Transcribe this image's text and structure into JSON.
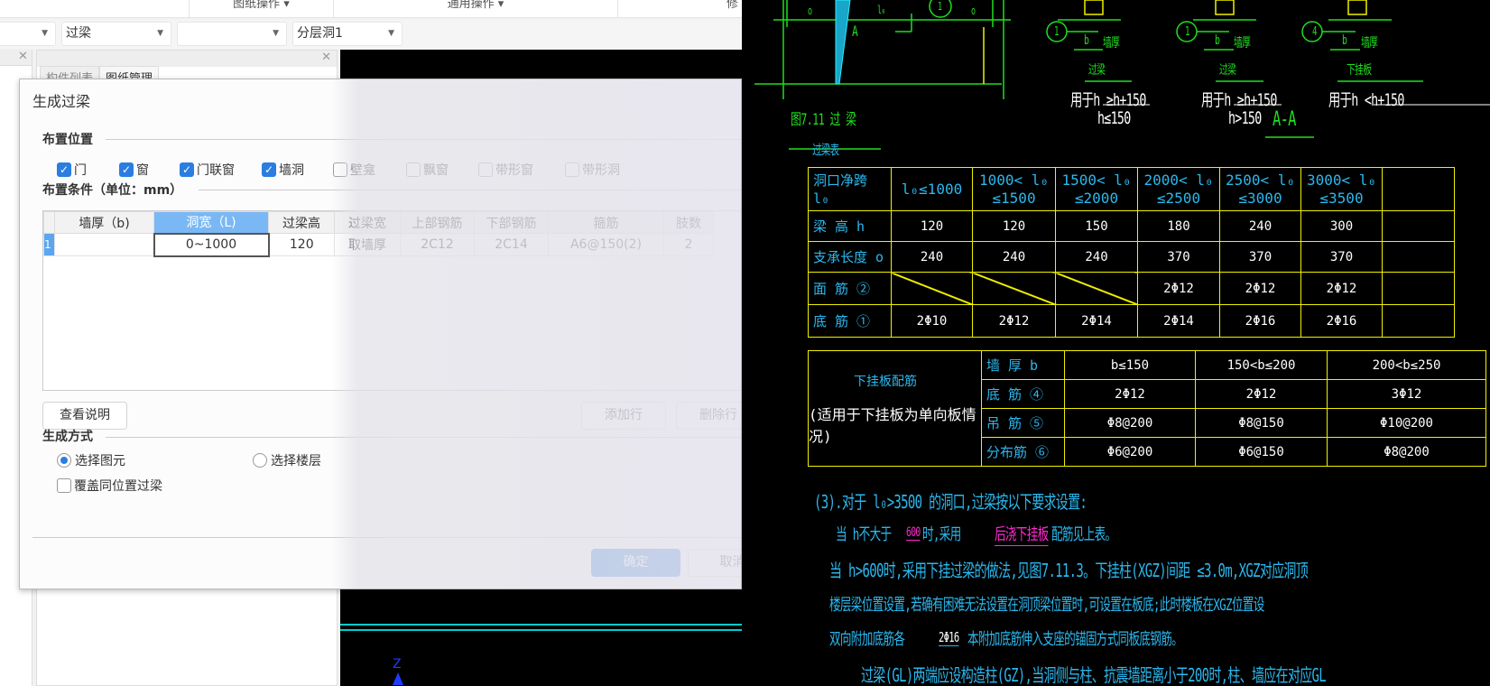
{
  "ribbon": {
    "groups": [
      "图纸操作 ▾",
      "通用操作 ▾",
      "修"
    ]
  },
  "toolbar": {
    "selects": [
      {
        "value": ""
      },
      {
        "value": "过梁"
      },
      {
        "value": ""
      },
      {
        "value": "分层洞1"
      }
    ]
  },
  "panes": {
    "tabs": [
      {
        "label": "构件列表"
      },
      {
        "label": "图纸管理"
      }
    ]
  },
  "dialog": {
    "title": "生成过梁",
    "placement_section": "布置位置",
    "placement_options": [
      {
        "label": "门",
        "checked": true
      },
      {
        "label": "窗",
        "checked": true
      },
      {
        "label": "门联窗",
        "checked": true
      },
      {
        "label": "墙洞",
        "checked": true
      },
      {
        "label": "壁龛",
        "checked": false
      },
      {
        "label": "飘窗",
        "checked": false
      },
      {
        "label": "带形窗",
        "checked": false
      },
      {
        "label": "带形洞",
        "checked": false
      }
    ],
    "conditions_section": "布置条件（单位：mm）",
    "grid": {
      "columns": [
        "墙厚（b)",
        "洞宽（L)",
        "过梁高",
        "过梁宽",
        "上部钢筋",
        "下部钢筋",
        "箍筋",
        "肢数"
      ],
      "rows": [
        {
          "num": "1",
          "cells": [
            "",
            "0~1000",
            "120",
            "取墙厚",
            "2C12",
            "2C14",
            "A6@150(2)",
            "2"
          ]
        }
      ]
    },
    "view_help": "查看说明",
    "add_row": "添加行",
    "delete_row": "删除行",
    "method_section": "生成方式",
    "method_options": [
      {
        "label": "选择图元",
        "selected": true
      },
      {
        "label": "选择楼层",
        "selected": false
      }
    ],
    "overwrite": {
      "label": "覆盖同位置过梁",
      "checked": false
    },
    "ok": "确定",
    "cancel": "取消"
  },
  "cad": {
    "fig_labels": {
      "o1": "o",
      "l0": "l₀",
      "o2": "o",
      "A": "A",
      "c1": "1",
      "fig_title": "图7.11  过  梁",
      "table_title": "过梁表"
    },
    "sections": [
      {
        "circle": "1",
        "b": "b",
        "wall": "墙厚",
        "name": "过梁",
        "cond1": "用于h ≥h+150",
        "cond2": "h≤150"
      },
      {
        "circle": "1",
        "b": "b",
        "wall": "墙厚",
        "name": "过梁",
        "cond1": "用于h ≥h+150",
        "cond2": "h>150"
      },
      {
        "circle": "4",
        "b": "b",
        "wall": "墙厚",
        "name": "下挂板",
        "cond1": "用于h <h+150",
        "cond2": ""
      }
    ],
    "aa": "A-A",
    "beam_table": {
      "header": [
        "洞口净跨    l₀",
        "l₀≤1000",
        "1000< l₀\n≤1500",
        "1500< l₀\n≤2000",
        "2000< l₀\n≤2500",
        "2500< l₀\n≤3000",
        "3000< l₀\n≤3500",
        ""
      ],
      "rows": [
        {
          "label": "梁 高    h",
          "values": [
            "120",
            "120",
            "150",
            "180",
            "240",
            "300",
            ""
          ]
        },
        {
          "label": "支承长度    o",
          "values": [
            "240",
            "240",
            "240",
            "370",
            "370",
            "370",
            ""
          ]
        },
        {
          "label": "面 筋   ②",
          "values": [
            "",
            "",
            "",
            "2Φ12",
            "2Φ12",
            "2Φ12",
            ""
          ]
        },
        {
          "label": "底 筋   ①",
          "values": [
            "2Φ10",
            "2Φ12",
            "2Φ14",
            "2Φ14",
            "2Φ16",
            "2Φ16",
            ""
          ]
        }
      ]
    },
    "hang_table": {
      "title": "下挂板配筋",
      "subtitle": "(适用于下挂板为单向板情况)",
      "rows": [
        {
          "label": "墙 厚  b",
          "values": [
            "b≤150",
            "150<b≤200",
            "200<b≤250"
          ]
        },
        {
          "label": "底 筋   ④",
          "values": [
            "2Φ12",
            "2Φ12",
            "3Φ12"
          ]
        },
        {
          "label": "吊 筋   ⑤",
          "values": [
            "Φ8@200",
            "Φ8@150",
            "Φ10@200"
          ]
        },
        {
          "label": "分布筋  ⑥",
          "values": [
            "Φ6@200",
            "Φ6@150",
            "Φ8@200"
          ]
        }
      ]
    },
    "notes": [
      "(3).对于 l₀>3500 的洞口,过梁按以下要求设置:",
      "当 h不大于",
      "600",
      "时,采用",
      "后浇下挂板",
      "配筋见上表。",
      "当 h>600时,采用下挂过梁的做法,见图7.11.3。下挂柱(XGZ)间距  ≤3.0m,XGZ对应洞顶",
      "楼层梁位置设置,若确有困难无法设置在洞顶梁位置时,可设置在板底;此时楼板在XGZ位置设",
      "双向附加底筋各",
      "2Φ16",
      "本附加底筋伸入支座的锚固方式同板底钢筋。",
      "过梁(GL)两端应设构造柱(GZ),当洞侧与柱、抗震墙距离小于200时,柱、墙应在对应GL"
    ],
    "axis_label": "Z"
  }
}
